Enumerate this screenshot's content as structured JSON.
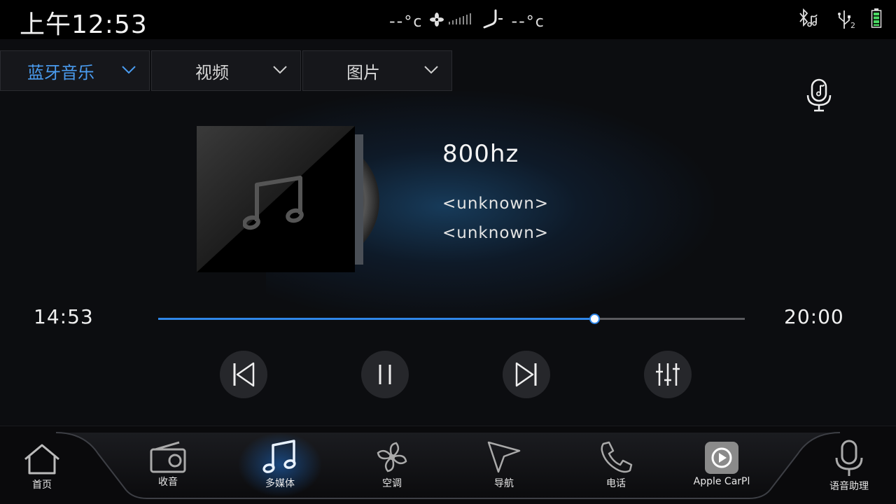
{
  "status_bar": {
    "time": "上午12:53",
    "driver_temp": "--",
    "passenger_temp": "--",
    "temp_unit": "°c",
    "usb_label": "2",
    "icons": [
      "fan-icon",
      "seat-airflow-icon",
      "bluetooth-music-icon",
      "usb-icon",
      "battery-icon"
    ]
  },
  "tabs": [
    {
      "label": "蓝牙音乐",
      "active": true
    },
    {
      "label": "视频",
      "active": false
    },
    {
      "label": "图片",
      "active": false
    }
  ],
  "track": {
    "title": "800hz",
    "artist": "<unknown>",
    "album": "<unknown>"
  },
  "playback": {
    "current_time": "14:53",
    "total_time": "20:00",
    "progress_fraction": 0.744
  },
  "controls": [
    "previous-icon",
    "pause-icon",
    "next-icon",
    "equalizer-icon"
  ],
  "nav": {
    "items": [
      {
        "label": "首页",
        "icon": "home-icon"
      },
      {
        "label": "收音",
        "icon": "radio-icon"
      },
      {
        "label": "多媒体",
        "icon": "music-note-icon",
        "active": true
      },
      {
        "label": "空调",
        "icon": "fan-icon"
      },
      {
        "label": "导航",
        "icon": "navigation-icon"
      },
      {
        "label": "电话",
        "icon": "phone-icon"
      },
      {
        "label": "Apple CarPl",
        "icon": "carplay-icon"
      },
      {
        "label": "语音助理",
        "icon": "microphone-icon"
      }
    ]
  },
  "colors": {
    "accent": "#2f86e8",
    "active_tab": "#4a9cf0",
    "background": "#0c0d10"
  }
}
